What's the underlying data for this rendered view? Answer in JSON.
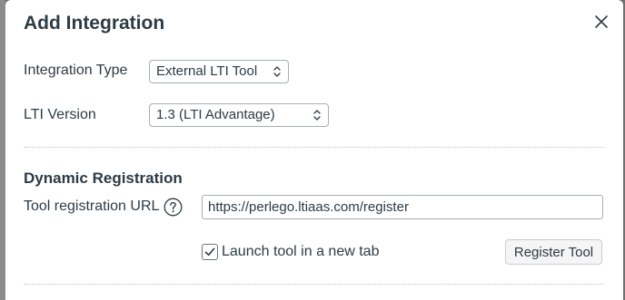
{
  "dialog": {
    "title": "Add Integration"
  },
  "fields": {
    "integration_type": {
      "label": "Integration Type",
      "value": "External LTI Tool"
    },
    "lti_version": {
      "label": "LTI Version",
      "value": "1.3 (LTI Advantage)"
    }
  },
  "dynamic_registration": {
    "heading": "Dynamic Registration",
    "url_label": "Tool registration URL",
    "url_value": "https://perlego.ltiaas.com/register",
    "launch_new_tab_label": "Launch tool in a new tab",
    "launch_new_tab_checked": true,
    "register_button_label": "Register Tool"
  },
  "icons": {
    "close": "close-icon",
    "help": "help-circle-icon",
    "caret": "select-caret-icon",
    "check": "checkmark-icon"
  }
}
